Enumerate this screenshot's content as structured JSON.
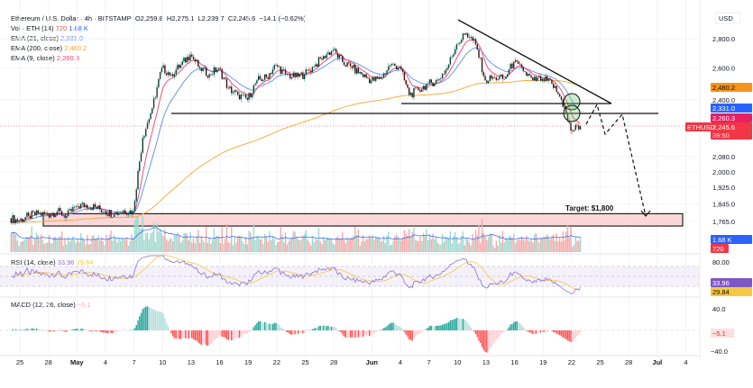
{
  "header": {
    "symbol": "Ethereum / U.S. Dollar · 4h · BITSTAMP",
    "open": "O2,259.8",
    "high": "H2,275.1",
    "low": "L2,239.7",
    "close": "C2,245.6",
    "change": "−14.1 (−0.62%)"
  },
  "indicators": {
    "vol": {
      "label": "Vol · ETH (14)",
      "v1": "720",
      "v2": "1.68 K"
    },
    "ema21": {
      "label": "EMA (21, close)",
      "value": "2,331.0"
    },
    "ema200": {
      "label": "EMA (200, close)",
      "value": "2,480.2"
    },
    "ema9": {
      "label": "EMA (9, close)",
      "value": "2,260.3"
    },
    "rsi": {
      "label": "RSI (14, close)",
      "v1": "33.96",
      "v2": "29.84"
    },
    "macd": {
      "label": "MACD (12, 26, close)",
      "value": "−5.1"
    }
  },
  "currency": "USD",
  "colors": {
    "ema21": "#5b8def",
    "ema200": "#f7a531",
    "ema9": "#f23d6d",
    "rsi": "#8e6fd6",
    "rsi_ma": "#f5c842",
    "up": "#26a69a",
    "down": "#ef5350",
    "target_zone": "#f8c9cc"
  },
  "price_axis": {
    "ticks": [
      "2,800.0",
      "2,600.0",
      "2,400.0",
      "2,080.0",
      "2,000.0",
      "1,925.0",
      "1,845.0",
      "1,765.0"
    ],
    "badges": {
      "ema200": "2,480.2",
      "ema21": "2,331.0",
      "ema9": "2,260.3",
      "last": "2,245.6",
      "countdown": "39:50",
      "symbol_tag": "ETHUSD",
      "vol_ma": "1.68 K",
      "vol": "720"
    }
  },
  "rsi_axis": {
    "tick": "80.00",
    "badge_rsi": "33.96",
    "badge_ma": "29.84"
  },
  "macd_axis": {
    "ticks": [
      "40.0",
      "−40.0"
    ],
    "badge": "−5.1"
  },
  "time_axis": [
    "25",
    "28",
    "May",
    "4",
    "7",
    "10",
    "13",
    "16",
    "19",
    "22",
    "25",
    "28",
    "Jun",
    "4",
    "7",
    "10",
    "13",
    "16",
    "19",
    "22",
    "25",
    "28",
    "Jul",
    "4"
  ],
  "annotations": {
    "target": "Target: $1,800"
  },
  "chart_data": {
    "type": "candlestick",
    "timeframe": "4h",
    "y_scale": "log",
    "ylim": [
      1685,
      2950
    ],
    "x_range": [
      "Apr 24",
      "Jul 6"
    ],
    "daily_close": {
      "dates": [
        "Apr 24",
        "Apr 25",
        "Apr 26",
        "Apr 27",
        "Apr 28",
        "Apr 29",
        "Apr 30",
        "May 1",
        "May 2",
        "May 3",
        "May 4",
        "May 5",
        "May 6",
        "May 7",
        "May 8",
        "May 9",
        "May 10",
        "May 11",
        "May 12",
        "May 13",
        "May 14",
        "May 15",
        "May 16",
        "May 17",
        "May 18",
        "May 19",
        "May 20",
        "May 21",
        "May 22",
        "May 23",
        "May 24",
        "May 25",
        "May 26",
        "May 27",
        "May 28",
        "May 29",
        "May 30",
        "May 31",
        "Jun 1",
        "Jun 2",
        "Jun 3",
        "Jun 4",
        "Jun 5",
        "Jun 6",
        "Jun 7",
        "Jun 8",
        "Jun 9",
        "Jun 10",
        "Jun 11",
        "Jun 12",
        "Jun 13",
        "Jun 14",
        "Jun 15",
        "Jun 16",
        "Jun 17",
        "Jun 18",
        "Jun 19",
        "Jun 20",
        "Jun 21",
        "Jun 22",
        "Jun 23"
      ],
      "values": [
        1780,
        1770,
        1790,
        1800,
        1795,
        1810,
        1790,
        1835,
        1840,
        1830,
        1810,
        1800,
        1815,
        1810,
        2180,
        2350,
        2600,
        2560,
        2620,
        2690,
        2600,
        2560,
        2600,
        2470,
        2430,
        2400,
        2520,
        2540,
        2620,
        2560,
        2540,
        2560,
        2610,
        2680,
        2720,
        2640,
        2600,
        2560,
        2520,
        2530,
        2620,
        2610,
        2430,
        2460,
        2500,
        2520,
        2600,
        2760,
        2840,
        2760,
        2520,
        2540,
        2530,
        2640,
        2580,
        2520,
        2530,
        2500,
        2400,
        2220,
        2245.6
      ]
    },
    "target_zone": [
      1745,
      1800
    ],
    "support_level": 2340,
    "neckline": 2380,
    "rsi_bands": [
      30,
      50,
      70
    ]
  }
}
